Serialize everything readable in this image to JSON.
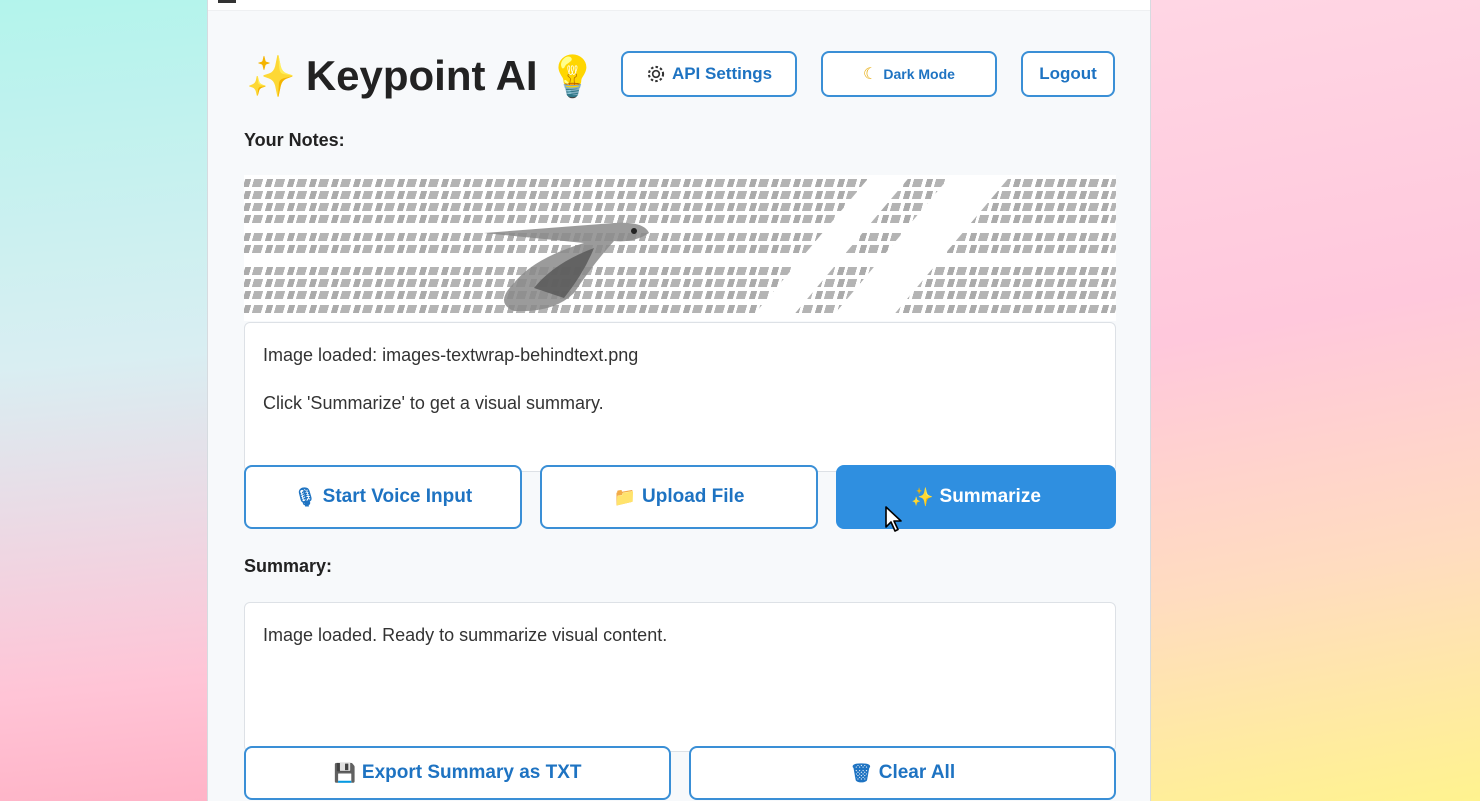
{
  "header": {
    "title": "Keypoint AI",
    "title_emoji_left": "✨",
    "title_emoji_right": "💡",
    "api_settings_label": "API Settings",
    "dark_mode_label": "Dark Mode",
    "logout_label": "Logout"
  },
  "notes": {
    "label": "Your Notes:",
    "line1": "Image loaded: images-textwrap-behindtext.png",
    "line2": "Click 'Summarize' to get a visual summary."
  },
  "actions": {
    "voice_label": "Start Voice Input",
    "upload_label": "Upload File",
    "summarize_label": "Summarize"
  },
  "summary": {
    "label": "Summary:",
    "text": "Image loaded. Ready to summarize visual content."
  },
  "footer": {
    "export_label": "Export Summary as TXT",
    "clear_label": "Clear All"
  },
  "icons": {
    "api": "gear-icon",
    "dark": "moon-icon",
    "voice": "microphone-icon",
    "upload": "folder-icon",
    "summarize": "sparkles-icon",
    "export": "floppy-disk-icon",
    "clear": "trash-icon"
  },
  "colors": {
    "accent": "#2f8fe0",
    "accent_text": "#1e73c2",
    "panel": "#f7f9fb"
  }
}
